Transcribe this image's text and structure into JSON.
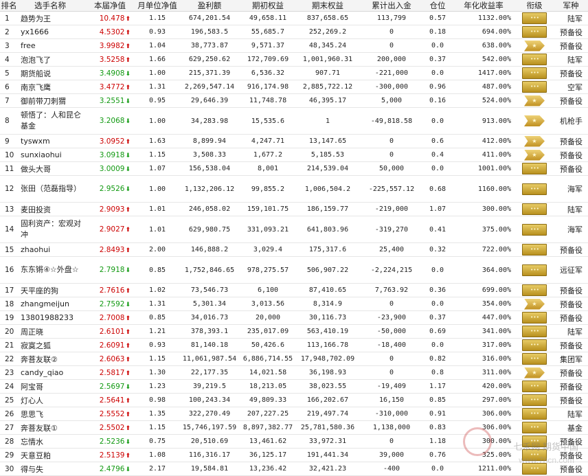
{
  "columns": [
    "排名",
    "选手名称",
    "本届净值",
    "月单位净值",
    "盈利额",
    "期初权益",
    "期末权益",
    "累计出入金",
    "仓位",
    "年化收益率",
    "衔级",
    "军种"
  ],
  "colors": {
    "up": "#cc0000",
    "down": "#119911"
  },
  "rows": [
    {
      "rank": "1",
      "name": "趋势为王",
      "nav": "10.478",
      "dir": "up",
      "month": "1.15",
      "profit": "674,201.54",
      "start": "49,658.11",
      "end": "837,658.65",
      "flow": "113,799",
      "pos": "0.57",
      "rate": "1132.00%",
      "badge": "bars",
      "branch": "陆军"
    },
    {
      "rank": "2",
      "name": "yx1666",
      "nav": "4.5302",
      "dir": "up",
      "month": "0.93",
      "profit": "196,583.5",
      "start": "55,685.7",
      "end": "252,269.2",
      "flow": "0",
      "pos": "0.18",
      "rate": "694.00%",
      "badge": "bars",
      "branch": "预备役"
    },
    {
      "rank": "3",
      "name": "free",
      "nav": "3.9982",
      "dir": "up",
      "month": "1.04",
      "profit": "38,773.87",
      "start": "9,571.37",
      "end": "48,345.24",
      "flow": "0",
      "pos": "0.0",
      "rate": "638.00%",
      "badge": "chev",
      "branch": "预备役"
    },
    {
      "rank": "4",
      "name": "泡泡飞了",
      "nav": "3.5258",
      "dir": "up",
      "month": "1.66",
      "profit": "629,250.62",
      "start": "172,709.69",
      "end": "1,001,960.31",
      "flow": "200,000",
      "pos": "0.37",
      "rate": "542.00%",
      "badge": "bars",
      "branch": "陆军"
    },
    {
      "rank": "5",
      "name": "期货船说",
      "nav": "3.4908",
      "dir": "down",
      "month": "1.00",
      "profit": "215,371.39",
      "start": "6,536.32",
      "end": "907.71",
      "flow": "-221,000",
      "pos": "0.0",
      "rate": "1417.00%",
      "badge": "bars",
      "branch": "预备役"
    },
    {
      "rank": "6",
      "name": "南京飞鹰",
      "nav": "3.4772",
      "dir": "up",
      "month": "1.31",
      "profit": "2,269,547.14",
      "start": "916,174.98",
      "end": "2,885,722.12",
      "flow": "-300,000",
      "pos": "0.96",
      "rate": "487.00%",
      "badge": "bars",
      "branch": "空军"
    },
    {
      "rank": "7",
      "name": "御前带刀刺猬",
      "nav": "3.2551",
      "dir": "down",
      "month": "0.95",
      "profit": "29,646.39",
      "start": "11,748.78",
      "end": "46,395.17",
      "flow": "5,000",
      "pos": "0.16",
      "rate": "524.00%",
      "badge": "chev",
      "branch": "预备役"
    },
    {
      "rank": "8",
      "name": "顿悟了：人和昆仑基金",
      "nav": "3.2068",
      "dir": "down",
      "month": "1.00",
      "profit": "34,283.98",
      "start": "15,535.6",
      "end": "1",
      "flow": "-49,818.58",
      "pos": "0.0",
      "rate": "913.00%",
      "badge": "chev",
      "branch": "机枪手",
      "tall": true
    },
    {
      "rank": "9",
      "name": "tyswxm",
      "nav": "3.0952",
      "dir": "up",
      "month": "1.63",
      "profit": "8,899.94",
      "start": "4,247.71",
      "end": "13,147.65",
      "flow": "0",
      "pos": "0.6",
      "rate": "412.00%",
      "badge": "chev",
      "branch": "预备役"
    },
    {
      "rank": "10",
      "name": "sunxiaohui",
      "nav": "3.0918",
      "dir": "down",
      "month": "1.15",
      "profit": "3,508.33",
      "start": "1,677.2",
      "end": "5,185.53",
      "flow": "0",
      "pos": "0.4",
      "rate": "411.00%",
      "badge": "chev",
      "branch": "预备役"
    },
    {
      "rank": "11",
      "name": "做头大哥",
      "nav": "3.0009",
      "dir": "down",
      "month": "1.07",
      "profit": "156,538.04",
      "start": "8,001",
      "end": "214,539.04",
      "flow": "50,000",
      "pos": "0.0",
      "rate": "1001.00%",
      "badge": "bars",
      "branch": "预备役"
    },
    {
      "rank": "12",
      "name": "张田（范磊指导）",
      "nav": "2.9526",
      "dir": "down",
      "month": "1.00",
      "profit": "1,132,206.12",
      "start": "99,855.2",
      "end": "1,006,504.2",
      "flow": "-225,557.12",
      "pos": "0.68",
      "rate": "1160.00%",
      "badge": "bars",
      "branch": "海军",
      "tall": true
    },
    {
      "rank": "13",
      "name": "麦田投资",
      "nav": "2.9093",
      "dir": "up",
      "month": "1.01",
      "profit": "246,058.02",
      "start": "159,101.75",
      "end": "186,159.77",
      "flow": "-219,000",
      "pos": "1.07",
      "rate": "300.00%",
      "badge": "bars",
      "branch": "陆军"
    },
    {
      "rank": "14",
      "name": "固利资产：宏观对冲",
      "nav": "2.9027",
      "dir": "up",
      "month": "1.01",
      "profit": "629,980.75",
      "start": "331,093.21",
      "end": "641,803.96",
      "flow": "-319,270",
      "pos": "0.41",
      "rate": "375.00%",
      "badge": "bars",
      "branch": "海军",
      "tall": true
    },
    {
      "rank": "15",
      "name": "zhaohui",
      "nav": "2.8493",
      "dir": "up",
      "month": "2.00",
      "profit": "146,888.2",
      "start": "3,029.4",
      "end": "175,317.6",
      "flow": "25,400",
      "pos": "0.32",
      "rate": "722.00%",
      "badge": "bars",
      "branch": "预备役"
    },
    {
      "rank": "16",
      "name": "东东锵④☆外盘☆",
      "nav": "2.7918",
      "dir": "down",
      "month": "0.85",
      "profit": "1,752,846.65",
      "start": "978,275.57",
      "end": "506,907.22",
      "flow": "-2,224,215",
      "pos": "0.0",
      "rate": "364.00%",
      "badge": "bars",
      "branch": "远征军",
      "tall": true
    },
    {
      "rank": "17",
      "name": "天平座的狗",
      "nav": "2.7616",
      "dir": "up",
      "month": "1.02",
      "profit": "73,546.73",
      "start": "6,100",
      "end": "87,410.65",
      "flow": "7,763.92",
      "pos": "0.36",
      "rate": "699.00%",
      "badge": "bars",
      "branch": "预备役"
    },
    {
      "rank": "18",
      "name": "zhangmeijun",
      "nav": "2.7592",
      "dir": "down",
      "month": "1.31",
      "profit": "5,301.34",
      "start": "3,013.56",
      "end": "8,314.9",
      "flow": "0",
      "pos": "0.0",
      "rate": "354.00%",
      "badge": "chev",
      "branch": "预备役"
    },
    {
      "rank": "19",
      "name": "13801988233",
      "nav": "2.7008",
      "dir": "up",
      "month": "0.85",
      "profit": "34,016.73",
      "start": "20,000",
      "end": "30,116.73",
      "flow": "-23,900",
      "pos": "0.37",
      "rate": "447.00%",
      "badge": "bars",
      "branch": "预备役"
    },
    {
      "rank": "20",
      "name": "周正晓",
      "nav": "2.6101",
      "dir": "up",
      "month": "1.21",
      "profit": "378,393.1",
      "start": "235,017.09",
      "end": "563,410.19",
      "flow": "-50,000",
      "pos": "0.69",
      "rate": "341.00%",
      "badge": "bars",
      "branch": "陆军"
    },
    {
      "rank": "21",
      "name": "寂寞之狐",
      "nav": "2.6091",
      "dir": "up",
      "month": "0.93",
      "profit": "81,140.18",
      "start": "50,426.6",
      "end": "113,166.78",
      "flow": "-18,400",
      "pos": "0.0",
      "rate": "317.00%",
      "badge": "bars",
      "branch": "预备役"
    },
    {
      "rank": "22",
      "name": "奔菩友联②",
      "nav": "2.6063",
      "dir": "up",
      "month": "1.15",
      "profit": "11,061,987.54",
      "start": "6,886,714.55",
      "end": "17,948,702.09",
      "flow": "0",
      "pos": "0.82",
      "rate": "316.00%",
      "badge": "bars",
      "branch": "集团军"
    },
    {
      "rank": "23",
      "name": "candy_qiao",
      "nav": "2.5817",
      "dir": "up",
      "month": "1.30",
      "profit": "22,177.35",
      "start": "14,021.58",
      "end": "36,198.93",
      "flow": "0",
      "pos": "0.8",
      "rate": "311.00%",
      "badge": "chev",
      "branch": "预备役"
    },
    {
      "rank": "24",
      "name": "阿宝哥",
      "nav": "2.5697",
      "dir": "down",
      "month": "1.23",
      "profit": "39,219.5",
      "start": "18,213.05",
      "end": "38,023.55",
      "flow": "-19,409",
      "pos": "1.17",
      "rate": "420.00%",
      "badge": "bars",
      "branch": "预备役"
    },
    {
      "rank": "25",
      "name": "灯心人",
      "nav": "2.5641",
      "dir": "up",
      "month": "0.98",
      "profit": "100,243.34",
      "start": "49,809.33",
      "end": "166,202.67",
      "flow": "16,150",
      "pos": "0.85",
      "rate": "297.00%",
      "badge": "bars",
      "branch": "预备役"
    },
    {
      "rank": "26",
      "name": "思思飞",
      "nav": "2.5552",
      "dir": "up",
      "month": "1.35",
      "profit": "322,270.49",
      "start": "207,227.25",
      "end": "219,497.74",
      "flow": "-310,000",
      "pos": "0.91",
      "rate": "306.00%",
      "badge": "bars",
      "branch": "陆军"
    },
    {
      "rank": "27",
      "name": "奔菩友联①",
      "nav": "2.5502",
      "dir": "up",
      "month": "1.15",
      "profit": "15,746,197.59",
      "start": "8,897,382.77",
      "end": "25,781,580.36",
      "flow": "1,138,000",
      "pos": "0.83",
      "rate": "306.00%",
      "badge": "bars",
      "branch": "基金"
    },
    {
      "rank": "28",
      "name": "忘情水",
      "nav": "2.5236",
      "dir": "down",
      "month": "0.75",
      "profit": "20,510.69",
      "start": "13,461.62",
      "end": "33,972.31",
      "flow": "0",
      "pos": "1.18",
      "rate": "300.00%",
      "badge": "bars",
      "branch": "预备役"
    },
    {
      "rank": "29",
      "name": "天意豆粕",
      "nav": "2.5139",
      "dir": "up",
      "month": "1.08",
      "profit": "116,316.17",
      "start": "36,125.17",
      "end": "191,441.34",
      "flow": "39,000",
      "pos": "0.76",
      "rate": "325.00%",
      "badge": "bars",
      "branch": "预备役"
    },
    {
      "rank": "30",
      "name": "得与失",
      "nav": "2.4796",
      "dir": "down",
      "month": "2.17",
      "profit": "19,584.81",
      "start": "13,236.42",
      "end": "32,421.23",
      "flow": "-400",
      "pos": "0.0",
      "rate": "1211.00%",
      "badge": "bars",
      "branch": "预备役"
    }
  ],
  "watermark": {
    "line1": "七禾网 期货中国",
    "line2": "www.7hcn.com"
  }
}
